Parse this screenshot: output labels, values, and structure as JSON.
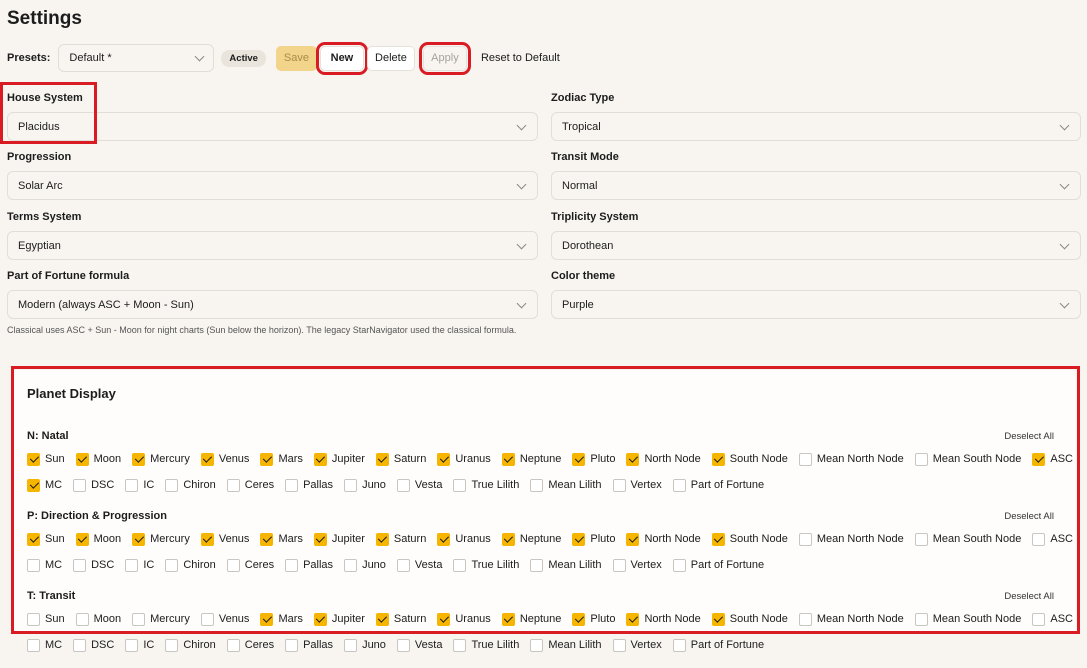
{
  "title": "Settings",
  "presets": {
    "label": "Presets:",
    "value": "Default *",
    "badge": "Active",
    "save": "Save",
    "new": "New",
    "delete": "Delete",
    "apply": "Apply",
    "reset": "Reset to Default"
  },
  "fields": {
    "house_system": {
      "label": "House System",
      "value": "Placidus"
    },
    "zodiac_type": {
      "label": "Zodiac Type",
      "value": "Tropical"
    },
    "progression": {
      "label": "Progression",
      "value": "Solar Arc"
    },
    "transit_mode": {
      "label": "Transit Mode",
      "value": "Normal"
    },
    "terms_system": {
      "label": "Terms System",
      "value": "Egyptian"
    },
    "triplicity_system": {
      "label": "Triplicity System",
      "value": "Dorothean"
    },
    "part_of_fortune": {
      "label": "Part of Fortune formula",
      "value": "Modern (always ASC + Moon - Sun)"
    },
    "color_theme": {
      "label": "Color theme",
      "value": "Purple"
    }
  },
  "help_text": "Classical uses ASC + Sun - Moon for night charts (Sun below the horizon). The legacy StarNavigator used the classical formula.",
  "planet_display": {
    "title": "Planet Display",
    "deselect_label": "Deselect All",
    "sections": [
      {
        "title": "N: Natal",
        "row1": [
          {
            "label": "Sun",
            "checked": true
          },
          {
            "label": "Moon",
            "checked": true
          },
          {
            "label": "Mercury",
            "checked": true
          },
          {
            "label": "Venus",
            "checked": true
          },
          {
            "label": "Mars",
            "checked": true
          },
          {
            "label": "Jupiter",
            "checked": true
          },
          {
            "label": "Saturn",
            "checked": true
          },
          {
            "label": "Uranus",
            "checked": true
          },
          {
            "label": "Neptune",
            "checked": true
          },
          {
            "label": "Pluto",
            "checked": true
          },
          {
            "label": "North Node",
            "checked": true
          },
          {
            "label": "South Node",
            "checked": true
          },
          {
            "label": "Mean North Node",
            "checked": false
          },
          {
            "label": "Mean South Node",
            "checked": false
          },
          {
            "label": "ASC",
            "checked": true
          }
        ],
        "row2": [
          {
            "label": "MC",
            "checked": true
          },
          {
            "label": "DSC",
            "checked": false
          },
          {
            "label": "IC",
            "checked": false
          },
          {
            "label": "Chiron",
            "checked": false
          },
          {
            "label": "Ceres",
            "checked": false
          },
          {
            "label": "Pallas",
            "checked": false
          },
          {
            "label": "Juno",
            "checked": false
          },
          {
            "label": "Vesta",
            "checked": false
          },
          {
            "label": "True Lilith",
            "checked": false
          },
          {
            "label": "Mean Lilith",
            "checked": false
          },
          {
            "label": "Vertex",
            "checked": false
          },
          {
            "label": "Part of Fortune",
            "checked": false
          }
        ]
      },
      {
        "title": "P: Direction & Progression",
        "row1": [
          {
            "label": "Sun",
            "checked": true
          },
          {
            "label": "Moon",
            "checked": true
          },
          {
            "label": "Mercury",
            "checked": true
          },
          {
            "label": "Venus",
            "checked": true
          },
          {
            "label": "Mars",
            "checked": true
          },
          {
            "label": "Jupiter",
            "checked": true
          },
          {
            "label": "Saturn",
            "checked": true
          },
          {
            "label": "Uranus",
            "checked": true
          },
          {
            "label": "Neptune",
            "checked": true
          },
          {
            "label": "Pluto",
            "checked": true
          },
          {
            "label": "North Node",
            "checked": true
          },
          {
            "label": "South Node",
            "checked": true
          },
          {
            "label": "Mean North Node",
            "checked": false
          },
          {
            "label": "Mean South Node",
            "checked": false
          },
          {
            "label": "ASC",
            "checked": false
          }
        ],
        "row2": [
          {
            "label": "MC",
            "checked": false
          },
          {
            "label": "DSC",
            "checked": false
          },
          {
            "label": "IC",
            "checked": false
          },
          {
            "label": "Chiron",
            "checked": false
          },
          {
            "label": "Ceres",
            "checked": false
          },
          {
            "label": "Pallas",
            "checked": false
          },
          {
            "label": "Juno",
            "checked": false
          },
          {
            "label": "Vesta",
            "checked": false
          },
          {
            "label": "True Lilith",
            "checked": false
          },
          {
            "label": "Mean Lilith",
            "checked": false
          },
          {
            "label": "Vertex",
            "checked": false
          },
          {
            "label": "Part of Fortune",
            "checked": false
          }
        ]
      },
      {
        "title": "T: Transit",
        "row1": [
          {
            "label": "Sun",
            "checked": false
          },
          {
            "label": "Moon",
            "checked": false
          },
          {
            "label": "Mercury",
            "checked": false
          },
          {
            "label": "Venus",
            "checked": false
          },
          {
            "label": "Mars",
            "checked": true
          },
          {
            "label": "Jupiter",
            "checked": true
          },
          {
            "label": "Saturn",
            "checked": true
          },
          {
            "label": "Uranus",
            "checked": true
          },
          {
            "label": "Neptune",
            "checked": true
          },
          {
            "label": "Pluto",
            "checked": true
          },
          {
            "label": "North Node",
            "checked": true
          },
          {
            "label": "South Node",
            "checked": true
          },
          {
            "label": "Mean North Node",
            "checked": false
          },
          {
            "label": "Mean South Node",
            "checked": false
          },
          {
            "label": "ASC",
            "checked": false
          }
        ],
        "row2": [
          {
            "label": "MC",
            "checked": false
          },
          {
            "label": "DSC",
            "checked": false
          },
          {
            "label": "IC",
            "checked": false
          },
          {
            "label": "Chiron",
            "checked": false
          },
          {
            "label": "Ceres",
            "checked": false
          },
          {
            "label": "Pallas",
            "checked": false
          },
          {
            "label": "Juno",
            "checked": false
          },
          {
            "label": "Vesta",
            "checked": false
          },
          {
            "label": "True Lilith",
            "checked": false
          },
          {
            "label": "Mean Lilith",
            "checked": false
          },
          {
            "label": "Vertex",
            "checked": false
          },
          {
            "label": "Part of Fortune",
            "checked": false
          }
        ]
      }
    ]
  },
  "colors": {
    "accent": "#f5b500",
    "highlight": "#d91c24",
    "background": "#f8f5f1"
  }
}
